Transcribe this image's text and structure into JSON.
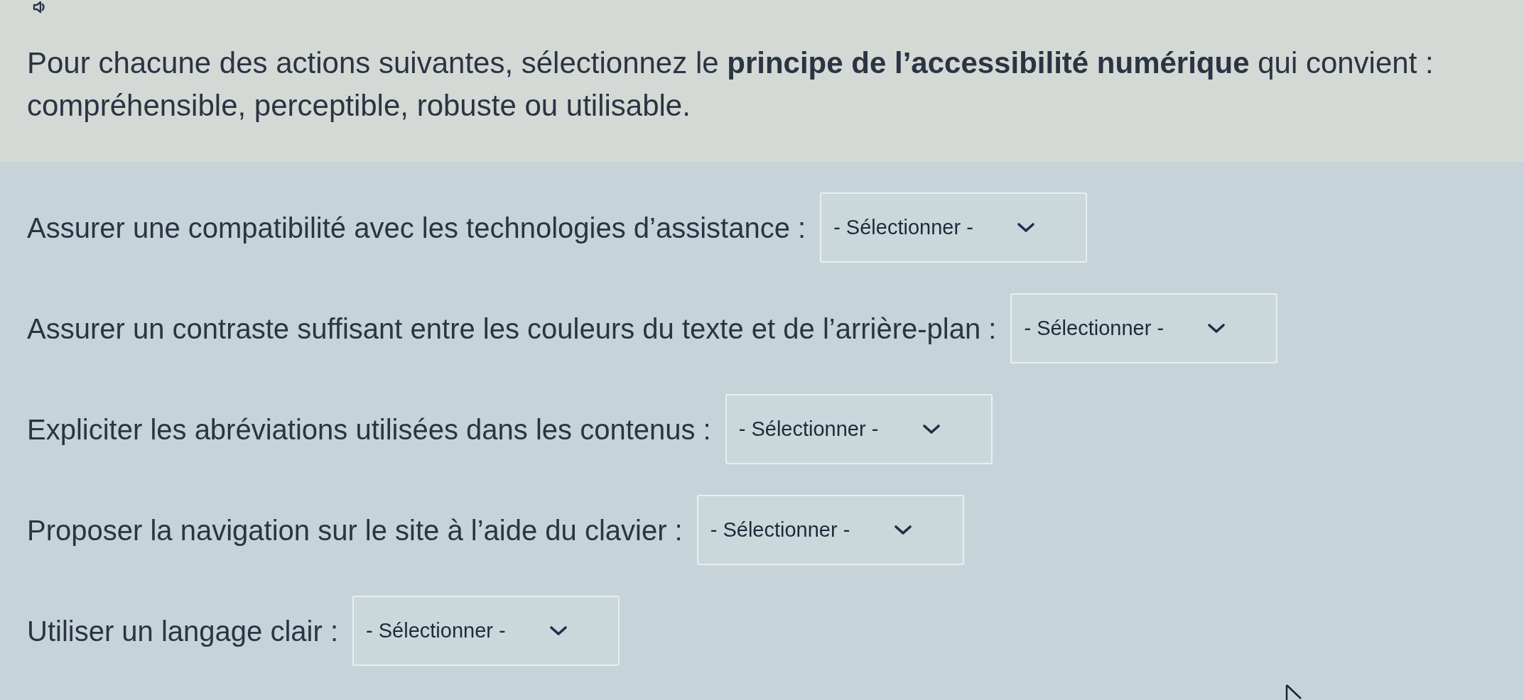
{
  "instructions": "Pour chacune des actions suivantes, sélectionnez le **principe de l’accessibilité numérique** qui convient : compréhensible, perceptible, robuste ou utilisable.",
  "items": [
    {
      "label": "Assurer une compatibilité avec les technologies d’assistance :",
      "dropdown": {
        "value": "- Sélectionner -"
      }
    },
    {
      "label": "Assurer un contraste suffisant entre les couleurs du texte et de l’arrière-plan :",
      "dropdown": {
        "value": "- Sélectionner -"
      }
    },
    {
      "label": "Expliciter les abréviations utilisées dans les contenus :",
      "dropdown": {
        "value": "- Sélectionner -"
      }
    },
    {
      "label": "Proposer la navigation sur le site à l’aide du clavier :",
      "dropdown": {
        "value": "- Sélectionner -"
      }
    },
    {
      "label": "Utiliser un langage clair :",
      "dropdown": {
        "value": "- Sélectionner -"
      }
    }
  ]
}
